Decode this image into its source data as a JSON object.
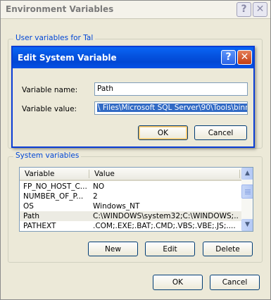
{
  "window": {
    "title": "Environment Variables",
    "help_glyph": "?",
    "close_glyph": "✕"
  },
  "user_vars": {
    "group_label": "User variables for Tal"
  },
  "dialog": {
    "title": "Edit System Variable",
    "help_glyph": "?",
    "close_glyph": "✕",
    "name_label": "Variable name:",
    "name_value": "Path",
    "value_label": "Variable value:",
    "value_value": "\\ Files\\Microsoft SQL Server\\90\\Tools\\binn\\",
    "ok_label": "OK",
    "cancel_label": "Cancel"
  },
  "system_vars": {
    "group_label": "System variables",
    "columns": [
      "Variable",
      "Value"
    ],
    "rows": [
      {
        "variable": "FP_NO_HOST_C...",
        "value": "NO"
      },
      {
        "variable": "NUMBER_OF_P...",
        "value": "2"
      },
      {
        "variable": "OS",
        "value": "Windows_NT"
      },
      {
        "variable": "Path",
        "value": "C:\\WINDOWS\\system32;C:\\WINDOWS;..."
      },
      {
        "variable": "PATHEXT",
        "value": ".COM;.EXE;.BAT;.CMD;.VBS;.VBE;.JS;...."
      }
    ],
    "new_label": "New",
    "edit_label": "Edit",
    "delete_label": "Delete"
  },
  "footer": {
    "ok_label": "OK",
    "cancel_label": "Cancel"
  },
  "colors": {
    "dialog_titlebar": "#0553e0",
    "group_label": "#0046d5",
    "selection": "#316ac5"
  }
}
